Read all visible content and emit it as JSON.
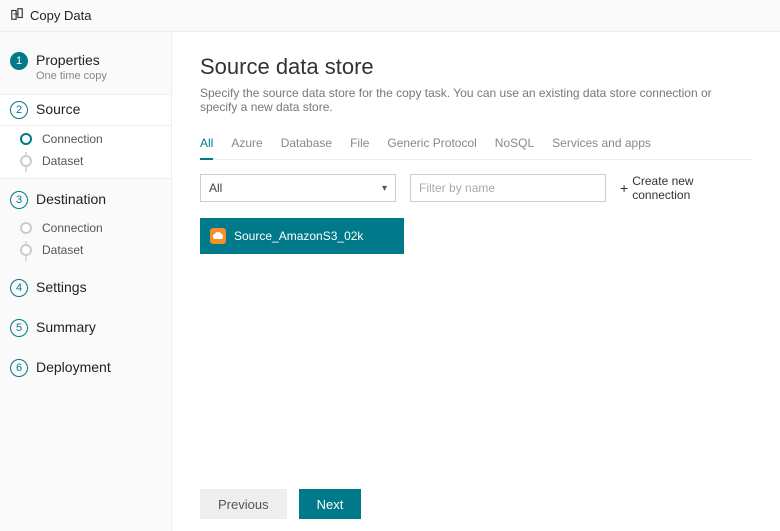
{
  "header": {
    "title": "Copy Data"
  },
  "wizard": {
    "steps": [
      {
        "num": "1",
        "label": "Properties",
        "sub": "One time copy"
      },
      {
        "num": "2",
        "label": "Source"
      },
      {
        "num": "3",
        "label": "Destination"
      },
      {
        "num": "4",
        "label": "Settings"
      },
      {
        "num": "5",
        "label": "Summary"
      },
      {
        "num": "6",
        "label": "Deployment"
      }
    ],
    "source_substeps": [
      {
        "label": "Connection"
      },
      {
        "label": "Dataset"
      }
    ],
    "dest_substeps": [
      {
        "label": "Connection"
      },
      {
        "label": "Dataset"
      }
    ]
  },
  "page": {
    "title": "Source data store",
    "desc": "Specify the source data store for the copy task. You can use an existing data store connection or specify a new data store."
  },
  "tabs": {
    "items": [
      "All",
      "Azure",
      "Database",
      "File",
      "Generic Protocol",
      "NoSQL",
      "Services and apps"
    ]
  },
  "filters": {
    "type_value": "All",
    "name_placeholder": "Filter by name",
    "create_label": "Create new connection"
  },
  "connections": [
    {
      "name": "Source_AmazonS3_02k"
    }
  ],
  "footer": {
    "previous": "Previous",
    "next": "Next"
  }
}
